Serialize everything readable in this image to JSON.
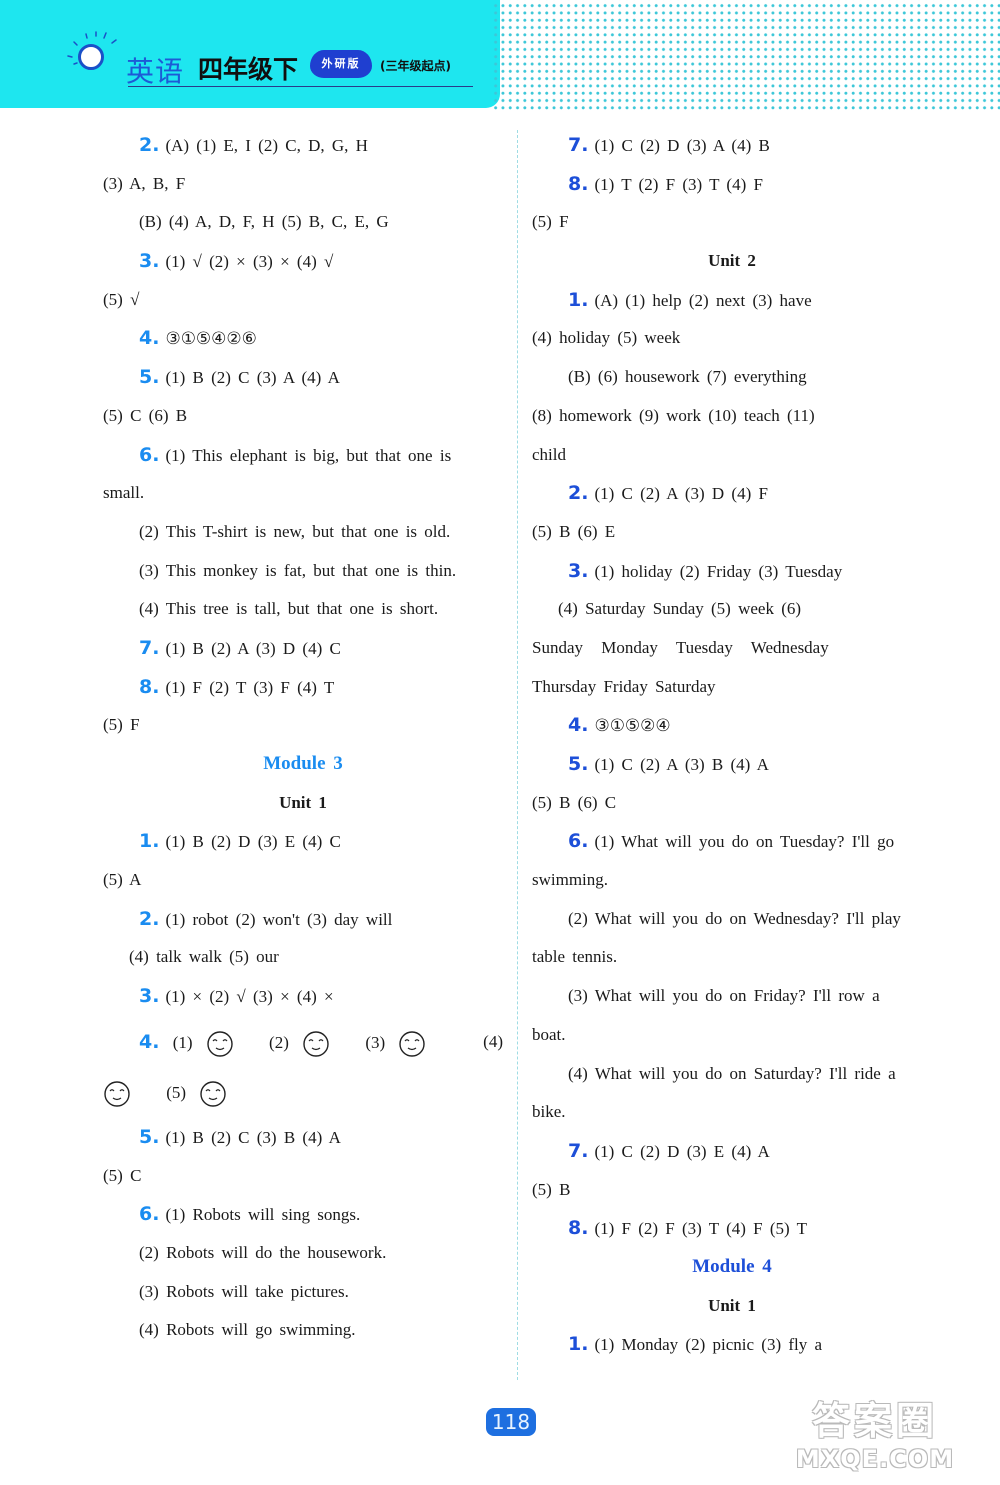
{
  "header": {
    "subject": "英语",
    "grade": "四年级下",
    "edition": "外研版",
    "start_note": "(三年级起点)"
  },
  "left_column": {
    "q2_a": {
      "num": "2.",
      "text": "(A)  (1) E, I   (2) C, D, G, H"
    },
    "q2_a_cont": "(3) A, B, F",
    "q2_b": "(B)  (4) A, D, F, H   (5) B, C, E, G",
    "q3": {
      "num": "3.",
      "text": "(1) √   (2) ×   (3) ×   (4) √"
    },
    "q3_cont": "(5) √",
    "q4": {
      "num": "4.",
      "text": "③①⑤④②⑥"
    },
    "q5": {
      "num": "5.",
      "text": "(1) B   (2) C   (3) A   (4) A"
    },
    "q5_cont": "(5) C   (6) B",
    "q6": {
      "num": "6.",
      "text": "(1) This elephant is big, but that one is"
    },
    "q6_cont": "small.",
    "q6_2": "(2) This T-shirt is new, but that one is old.",
    "q6_3": "(3) This monkey is fat, but that one is thin.",
    "q6_4": "(4) This tree is tall, but that one is short.",
    "q7": {
      "num": "7.",
      "text": "(1) B   (2) A   (3) D   (4) C"
    },
    "q8": {
      "num": "8.",
      "text": "(1) F   (2) T   (3) F   (4) T"
    },
    "q8_cont": "(5) F",
    "module_title": "Module 3",
    "unit_title": "Unit 1",
    "m3_q1": {
      "num": "1.",
      "text": "(1) B   (2) D   (3) E   (4) C"
    },
    "m3_q1_cont": "(5) A",
    "m3_q2": {
      "num": "2.",
      "text": "(1) robot   (2) won't   (3) day   will"
    },
    "m3_q2_cont": "(4) talk   walk   (5) our",
    "m3_q3": {
      "num": "3.",
      "text": "(1) ×   (2) √   (3) ×   (4) ×"
    },
    "m3_q4": {
      "num": "4.",
      "items": [
        "(1)",
        "(2)",
        "(3)",
        "(4)",
        "(5)"
      ],
      "icon": "smiley-face-icon"
    },
    "m3_q5": {
      "num": "5.",
      "text": "(1) B   (2) C   (3) B   (4) A"
    },
    "m3_q5_cont": "(5) C",
    "m3_q6": {
      "num": "6.",
      "text": "(1) Robots will sing songs."
    },
    "m3_q6_2": "(2) Robots will do the housework.",
    "m3_q6_3": "(3) Robots will take pictures.",
    "m3_q6_4": "(4) Robots will go swimming."
  },
  "right_column": {
    "q7": {
      "num": "7.",
      "text": "(1) C   (2) D   (3) A   (4) B"
    },
    "q8": {
      "num": "8.",
      "text": "(1) T   (2) F   (3) T   (4) F"
    },
    "q8_cont": "(5) F",
    "unit2_title": "Unit 2",
    "u2_q1": {
      "num": "1.",
      "text": "(A)  (1) help   (2) next   (3) have"
    },
    "u2_q1_cont": "(4) holiday   (5) week",
    "u2_q1_b": "(B)  (6) housework   (7) everything",
    "u2_q1_b_cont": "(8) homework   (9) work   (10) teach   (11)",
    "u2_q1_b_cont2": "child",
    "u2_q2": {
      "num": "2.",
      "text": "(1) C   (2) A   (3) D   (4) F"
    },
    "u2_q2_cont": "(5) B   (6) E",
    "u2_q3": {
      "num": "3.",
      "text": "(1) holiday   (2) Friday   (3) Tuesday"
    },
    "u2_q3_cont": "(4) Saturday   Sunday   (5) week   (6)",
    "u2_q3_cont2": "Sunday   Monday   Tuesday   Wednesday",
    "u2_q3_cont3": "Thursday   Friday   Saturday",
    "u2_q4": {
      "num": "4.",
      "text": "③①⑤②④"
    },
    "u2_q5": {
      "num": "5.",
      "text": "(1) C   (2) A   (3) B   (4) A"
    },
    "u2_q5_cont": "(5) B   (6) C",
    "u2_q6": {
      "num": "6.",
      "text": "(1) What will you do on Tuesday? I'll go"
    },
    "u2_q6_cont": "swimming.",
    "u2_q6_2": "(2) What will you do on Wednesday? I'll play",
    "u2_q6_2_cont": "table tennis.",
    "u2_q6_3": "(3) What will you do on Friday? I'll row a",
    "u2_q6_3_cont": "boat.",
    "u2_q6_4": "(4) What will you do on Saturday? I'll ride a",
    "u2_q6_4_cont": "bike.",
    "u2_q7": {
      "num": "7.",
      "text": "(1) C   (2) D   (3) E   (4) A"
    },
    "u2_q7_cont": "(5) B",
    "u2_q8": {
      "num": "8.",
      "text": "(1) F   (2) F   (3) T   (4) F   (5) T"
    },
    "module4_title": "Module 4",
    "m4_unit_title": "Unit 1",
    "m4_q1": {
      "num": "1.",
      "text": "(1) Monday   (2) picnic   (3) fly a"
    }
  },
  "footer": {
    "page_number": "118",
    "watermark_cn": "答案圈",
    "watermark_en": "MXQE.COM"
  },
  "colors": {
    "banner": "#1ee6ef",
    "left_accent": "#1a8cf0",
    "right_accent": "#1d4fd8",
    "page_badge": "#1e6fe0"
  }
}
